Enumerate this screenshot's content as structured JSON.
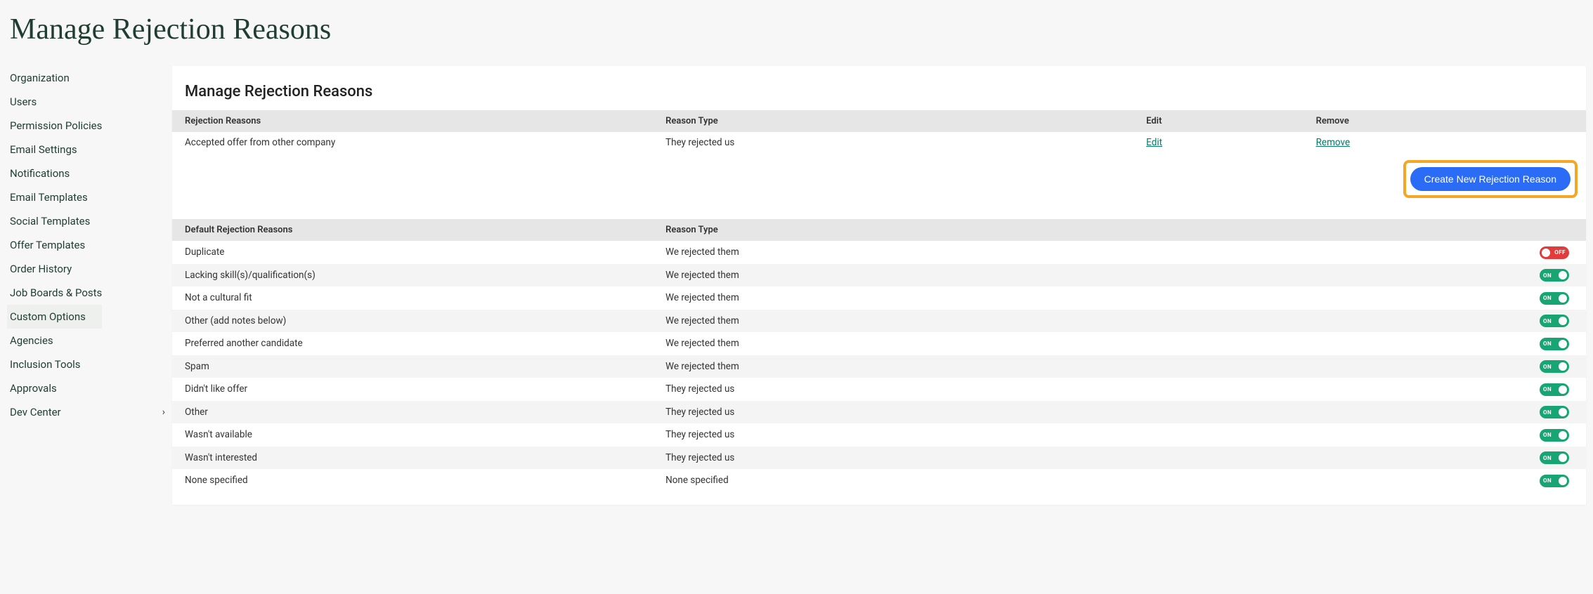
{
  "page": {
    "title": "Manage Rejection Reasons"
  },
  "sidebar": {
    "items": [
      {
        "label": "Organization",
        "active": false,
        "hasChevron": false
      },
      {
        "label": "Users",
        "active": false,
        "hasChevron": false
      },
      {
        "label": "Permission Policies",
        "active": false,
        "hasChevron": false
      },
      {
        "label": "Email Settings",
        "active": false,
        "hasChevron": false
      },
      {
        "label": "Notifications",
        "active": false,
        "hasChevron": false
      },
      {
        "label": "Email Templates",
        "active": false,
        "hasChevron": false
      },
      {
        "label": "Social Templates",
        "active": false,
        "hasChevron": false
      },
      {
        "label": "Offer Templates",
        "active": false,
        "hasChevron": false
      },
      {
        "label": "Order History",
        "active": false,
        "hasChevron": false
      },
      {
        "label": "Job Boards & Posts",
        "active": false,
        "hasChevron": false
      },
      {
        "label": "Custom Options",
        "active": true,
        "hasChevron": false
      },
      {
        "label": "Agencies",
        "active": false,
        "hasChevron": false
      },
      {
        "label": "Inclusion Tools",
        "active": false,
        "hasChevron": false
      },
      {
        "label": "Approvals",
        "active": false,
        "hasChevron": false
      },
      {
        "label": "Dev Center",
        "active": false,
        "hasChevron": true
      }
    ]
  },
  "section": {
    "title": "Manage Rejection Reasons"
  },
  "custom_table": {
    "headers": {
      "reason": "Rejection Reasons",
      "type": "Reason Type",
      "edit": "Edit",
      "remove": "Remove"
    },
    "rows": [
      {
        "reason": "Accepted offer from other company",
        "type": "They rejected us",
        "edit": "Edit",
        "remove": "Remove"
      }
    ]
  },
  "create_button": {
    "label": "Create New Rejection Reason"
  },
  "default_table": {
    "headers": {
      "reason": "Default Rejection Reasons",
      "type": "Reason Type"
    },
    "rows": [
      {
        "reason": "Duplicate",
        "type": "We rejected them",
        "state": "off"
      },
      {
        "reason": "Lacking skill(s)/qualification(s)",
        "type": "We rejected them",
        "state": "on"
      },
      {
        "reason": "Not a cultural fit",
        "type": "We rejected them",
        "state": "on"
      },
      {
        "reason": "Other (add notes below)",
        "type": "We rejected them",
        "state": "on"
      },
      {
        "reason": "Preferred another candidate",
        "type": "We rejected them",
        "state": "on"
      },
      {
        "reason": "Spam",
        "type": "We rejected them",
        "state": "on"
      },
      {
        "reason": "Didn't like offer",
        "type": "They rejected us",
        "state": "on"
      },
      {
        "reason": "Other",
        "type": "They rejected us",
        "state": "on"
      },
      {
        "reason": "Wasn't available",
        "type": "They rejected us",
        "state": "on"
      },
      {
        "reason": "Wasn't interested",
        "type": "They rejected us",
        "state": "on"
      },
      {
        "reason": "None specified",
        "type": "None specified",
        "state": "on"
      }
    ]
  },
  "toggle_labels": {
    "on": "ON",
    "off": "OFF"
  }
}
